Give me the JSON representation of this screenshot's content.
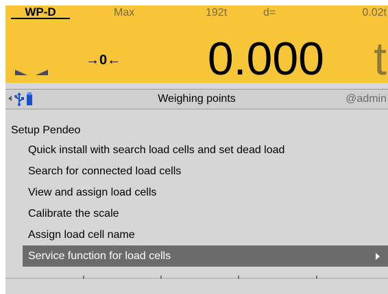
{
  "display": {
    "scale_id": "WP-D",
    "max_label": "Max",
    "max_value": "192t",
    "d_label": "d=",
    "d_value": "0.02t",
    "zero_indicator": "→0←",
    "weight": "0.000",
    "unit": "t",
    "icons": [
      "motion-indicator-icon",
      "center-of-zero-icon"
    ]
  },
  "title_bar": {
    "title": "Weighing points",
    "user": "@admin",
    "icons": [
      "back-arrow-icon",
      "usb-icon",
      "memory-stick-icon"
    ]
  },
  "menu": {
    "section_title": "Setup Pendeo",
    "items": [
      "Quick install with search load cells and set dead load",
      "Search for connected load cells",
      "View and assign load cells",
      "Calibrate the scale",
      "Assign load cell name",
      "Service function for load cells"
    ],
    "selected_index": 5
  },
  "colors": {
    "display_bg": "#f6c638",
    "menu_bg": "#d6d6d6",
    "selected_bg": "#6b6b6b"
  }
}
